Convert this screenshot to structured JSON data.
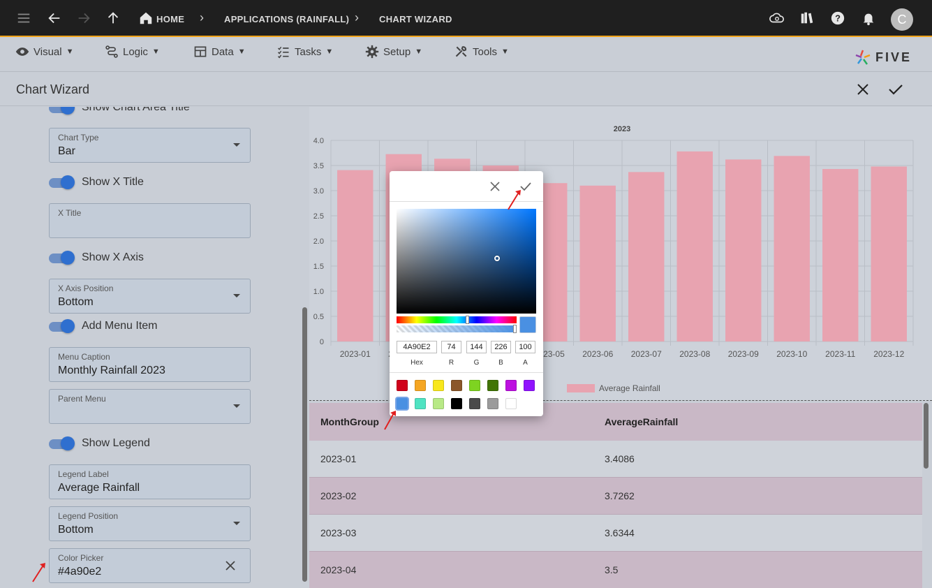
{
  "breadcrumb": {
    "home": "HOME",
    "app": "APPLICATIONS (RAINFALL)",
    "current": "CHART WIZARD"
  },
  "avatar": {
    "initial": "C"
  },
  "menubar": {
    "items": [
      {
        "label": "Visual",
        "icon": "eye-icon"
      },
      {
        "label": "Logic",
        "icon": "logic-icon"
      },
      {
        "label": "Data",
        "icon": "table-icon"
      },
      {
        "label": "Tasks",
        "icon": "tasks-icon"
      },
      {
        "label": "Setup",
        "icon": "gear-icon"
      },
      {
        "label": "Tools",
        "icon": "tools-icon"
      }
    ],
    "logo_text": "FIVE"
  },
  "page": {
    "title": "Chart Wizard"
  },
  "form": {
    "show_chart_area_title": "Show Chart Area Title",
    "chart_type": {
      "label": "Chart Type",
      "value": "Bar"
    },
    "show_x_title": "Show X Title",
    "x_title": {
      "label": "X Title",
      "value": ""
    },
    "show_x_axis": "Show X Axis",
    "x_axis_position": {
      "label": "X Axis Position",
      "value": "Bottom"
    },
    "add_menu_item": "Add Menu Item",
    "menu_caption": {
      "label": "Menu Caption",
      "value": "Monthly Rainfall 2023"
    },
    "parent_menu": {
      "label": "Parent Menu",
      "value": ""
    },
    "show_legend": "Show Legend",
    "legend_label": {
      "label": "Legend Label",
      "value": "Average Rainfall"
    },
    "legend_position": {
      "label": "Legend Position",
      "value": "Bottom"
    },
    "color_picker": {
      "label": "Color Picker",
      "value": "#4a90e2"
    }
  },
  "chart_data": {
    "type": "bar",
    "title": "2023",
    "categories": [
      "2023-01",
      "2023-02",
      "2023-03",
      "2023-04",
      "2023-05",
      "2023-06",
      "2023-07",
      "2023-08",
      "2023-09",
      "2023-10",
      "2023-11",
      "2023-12"
    ],
    "series": [
      {
        "name": "Average Rainfall",
        "values": [
          3.4086,
          3.7262,
          3.6344,
          3.5,
          3.15,
          3.1,
          3.37,
          3.78,
          3.62,
          3.69,
          3.43,
          3.48
        ]
      }
    ],
    "yticks": [
      "0",
      "0.5",
      "1.0",
      "1.5",
      "2.0",
      "2.5",
      "3.0",
      "3.5",
      "4.0"
    ],
    "ylim": [
      0,
      4.0
    ],
    "bar_color": "#e8a3b0",
    "grid": true,
    "legend": "bottom"
  },
  "table": {
    "headers": [
      "MonthGroup",
      "AverageRainfall"
    ],
    "rows": [
      [
        "2023-01",
        "3.4086"
      ],
      [
        "2023-02",
        "3.7262"
      ],
      [
        "2023-03",
        "3.6344"
      ],
      [
        "2023-04",
        "3.5"
      ]
    ]
  },
  "picker": {
    "hex": "4A90E2",
    "r": "74",
    "g": "144",
    "b": "226",
    "a": "100",
    "labels": {
      "hex": "Hex",
      "r": "R",
      "g": "G",
      "b": "B",
      "a": "A"
    },
    "hue_fraction": 0.59,
    "alpha_fraction": 1.0,
    "preview_color": "#4a90e2",
    "swatches": [
      "#d0021b",
      "#f5a623",
      "#f8e71c",
      "#8b572a",
      "#7ed321",
      "#417505",
      "#bd10e0",
      "#9013fe",
      "#4a90e2",
      "#50e3c2",
      "#b8e986",
      "#000000",
      "#4a4a4a",
      "#9b9b9b",
      "#ffffff"
    ],
    "selected_swatch": "#4a90e2"
  }
}
